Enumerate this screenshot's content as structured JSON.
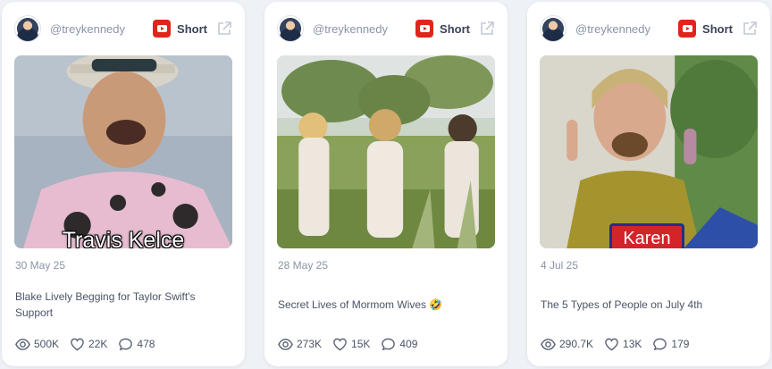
{
  "cards": [
    {
      "handle": "@treykennedy",
      "platform_icon": "youtube-icon",
      "type_label": "Short",
      "thumbnail_caption": "Travis Kelce",
      "date": "30 May 25",
      "title": "Blake Lively Begging for Taylor Swift's Support",
      "views": "500K",
      "likes": "22K",
      "comments": "478"
    },
    {
      "handle": "@treykennedy",
      "platform_icon": "youtube-icon",
      "type_label": "Short",
      "date": "28 May 25",
      "title": "Secret Lives of Mormom Wives 🤣",
      "views": "273K",
      "likes": "15K",
      "comments": "409"
    },
    {
      "handle": "@treykennedy",
      "platform_icon": "youtube-icon",
      "type_label": "Short",
      "thumbnail_caption": "Karen",
      "date": "4 Jul 25",
      "title": "The 5 Types of People on July 4th",
      "views": "290.7K",
      "likes": "13K",
      "comments": "179"
    }
  ],
  "colors": {
    "page_background": "#eef1f5",
    "youtube_red": "#e1251b",
    "muted_text": "#8a93a6",
    "body_text": "#4b5366"
  }
}
